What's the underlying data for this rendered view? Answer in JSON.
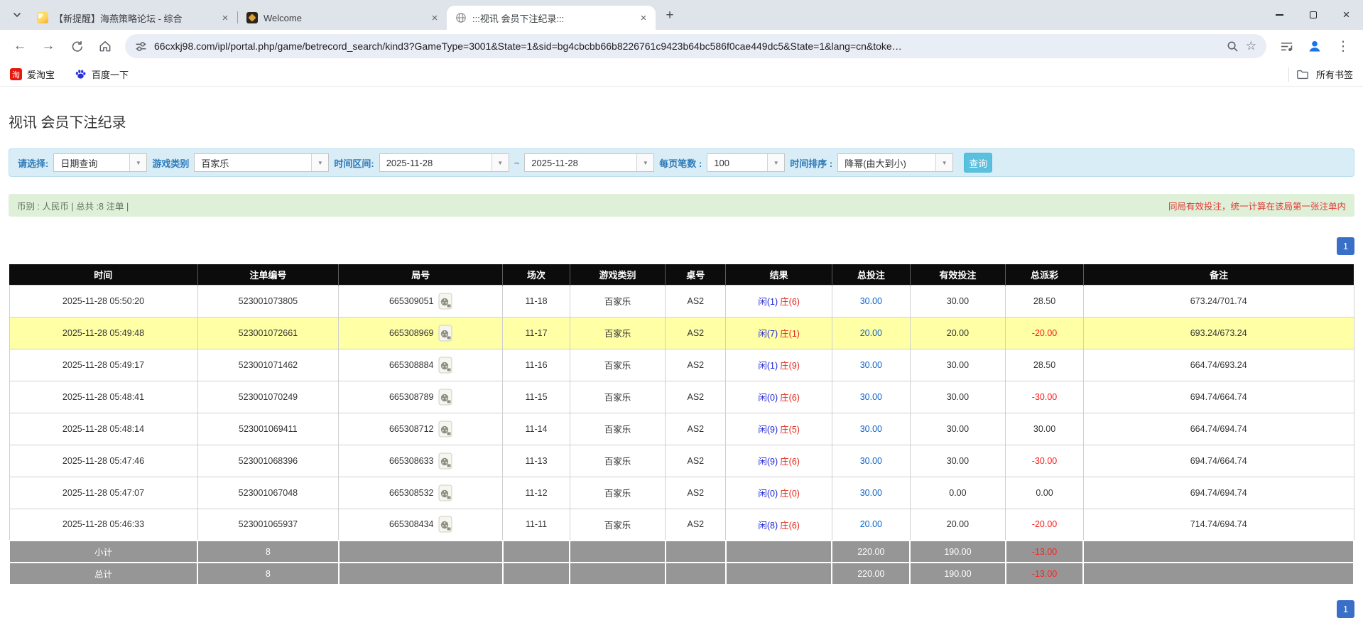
{
  "browser": {
    "tabs": [
      {
        "title": "【新提醒】海燕策略论坛 - 综合",
        "active": false
      },
      {
        "title": "Welcome",
        "active": false
      },
      {
        "title": ":::视讯 会员下注纪录:::",
        "active": true
      }
    ],
    "new_tab_glyph": "+",
    "window_controls": {
      "close_glyph": "×"
    },
    "toolbar": {
      "back_glyph": "←",
      "forward_glyph": "→",
      "url": "66cxkj98.com/ipl/portal.php/game/betrecord_search/kind3?GameType=3001&State=1&sid=bg4cbcbb66b8226761c9423b64bc586f0cae449dc5&State=1&lang=cn&toke…",
      "star_glyph": "☆",
      "menu_glyph": "⋮"
    },
    "bookmarks": [
      {
        "label": "爱淘宝",
        "icon_glyph": "淘"
      },
      {
        "label": "百度一下"
      }
    ],
    "bookmarks_right_label": "所有书签",
    "tab_close_glyph": "×"
  },
  "page": {
    "title": "视讯 会员下注纪录",
    "filters": {
      "mode_label": "请选择:",
      "mode_value": "日期查询",
      "game_type_label": "游戏类别",
      "game_type_value": "百家乐",
      "range_label": "时间区间:",
      "date_from": "2025-11-28",
      "tilde": "~",
      "date_to": "2025-11-28",
      "per_page_label": "每页笔数 :",
      "per_page_value": "100",
      "sort_label": "时间排序 :",
      "sort_value": "降幂(由大到小)",
      "search_button": "查询",
      "dropdown_arrow_glyph": "▼"
    },
    "summary_bar": {
      "left": "币别 : 人民币 | 总共 :8 注单 |",
      "right": "同局有效投注，统一计算在该局第一张注单内"
    },
    "pagination_page": "1",
    "table": {
      "headers": [
        "时间",
        "注单编号",
        "局号",
        "场次",
        "游戏类别",
        "桌号",
        "结果",
        "总投注",
        "有效投注",
        "总派彩",
        "备注"
      ],
      "rows": [
        {
          "time": "2025-11-28 05:50:20",
          "bet_id": "523001073805",
          "round_id": "665309051",
          "session": "11-18",
          "game": "百家乐",
          "table": "AS2",
          "result_player": "闲(1)",
          "result_banker": "庄(6)",
          "total_bet": "30.00",
          "valid_bet": "30.00",
          "payout": "28.50",
          "note": "673.24/701.74",
          "highlight": false
        },
        {
          "time": "2025-11-28 05:49:48",
          "bet_id": "523001072661",
          "round_id": "665308969",
          "session": "11-17",
          "game": "百家乐",
          "table": "AS2",
          "result_player": "闲(7)",
          "result_banker": "庄(1)",
          "total_bet": "20.00",
          "valid_bet": "20.00",
          "payout": "-20.00",
          "note": "693.24/673.24",
          "highlight": true
        },
        {
          "time": "2025-11-28 05:49:17",
          "bet_id": "523001071462",
          "round_id": "665308884",
          "session": "11-16",
          "game": "百家乐",
          "table": "AS2",
          "result_player": "闲(1)",
          "result_banker": "庄(9)",
          "total_bet": "30.00",
          "valid_bet": "30.00",
          "payout": "28.50",
          "note": "664.74/693.24",
          "highlight": false
        },
        {
          "time": "2025-11-28 05:48:41",
          "bet_id": "523001070249",
          "round_id": "665308789",
          "session": "11-15",
          "game": "百家乐",
          "table": "AS2",
          "result_player": "闲(0)",
          "result_banker": "庄(6)",
          "total_bet": "30.00",
          "valid_bet": "30.00",
          "payout": "-30.00",
          "note": "694.74/664.74",
          "highlight": false
        },
        {
          "time": "2025-11-28 05:48:14",
          "bet_id": "523001069411",
          "round_id": "665308712",
          "session": "11-14",
          "game": "百家乐",
          "table": "AS2",
          "result_player": "闲(9)",
          "result_banker": "庄(5)",
          "total_bet": "30.00",
          "valid_bet": "30.00",
          "payout": "30.00",
          "note": "664.74/694.74",
          "highlight": false
        },
        {
          "time": "2025-11-28 05:47:46",
          "bet_id": "523001068396",
          "round_id": "665308633",
          "session": "11-13",
          "game": "百家乐",
          "table": "AS2",
          "result_player": "闲(9)",
          "result_banker": "庄(6)",
          "total_bet": "30.00",
          "valid_bet": "30.00",
          "payout": "-30.00",
          "note": "694.74/664.74",
          "highlight": false
        },
        {
          "time": "2025-11-28 05:47:07",
          "bet_id": "523001067048",
          "round_id": "665308532",
          "session": "11-12",
          "game": "百家乐",
          "table": "AS2",
          "result_player": "闲(0)",
          "result_banker": "庄(0)",
          "total_bet": "30.00",
          "valid_bet": "0.00",
          "payout": "0.00",
          "note": "694.74/694.74",
          "highlight": false
        },
        {
          "time": "2025-11-28 05:46:33",
          "bet_id": "523001065937",
          "round_id": "665308434",
          "session": "11-11",
          "game": "百家乐",
          "table": "AS2",
          "result_player": "闲(8)",
          "result_banker": "庄(6)",
          "total_bet": "20.00",
          "valid_bet": "20.00",
          "payout": "-20.00",
          "note": "714.74/694.74",
          "highlight": false
        }
      ],
      "subtotal": {
        "label": "小计",
        "count": "8",
        "total_bet": "220.00",
        "valid_bet": "190.00",
        "payout": "-13.00"
      },
      "total": {
        "label": "总计",
        "count": "8",
        "total_bet": "220.00",
        "valid_bet": "190.00",
        "payout": "-13.00"
      }
    }
  },
  "colors": {
    "filter_bg": "#d9edf7",
    "filter_label_blue": "#2e7ab8",
    "search_button_cyan": "#5bc0de",
    "summary_bg_green": "#dff0d8",
    "alert_red": "#e03a36",
    "link_blue": "#0a64c8",
    "player_blue": "#2026d2",
    "banker_red": "#e02a22",
    "negative_red": "#ff1a1a",
    "highlight_yellow": "#ffffa6",
    "table_header_black": "#0c0c0c",
    "footer_gray": "#969696",
    "pagination_blue": "#3a6fc8"
  }
}
